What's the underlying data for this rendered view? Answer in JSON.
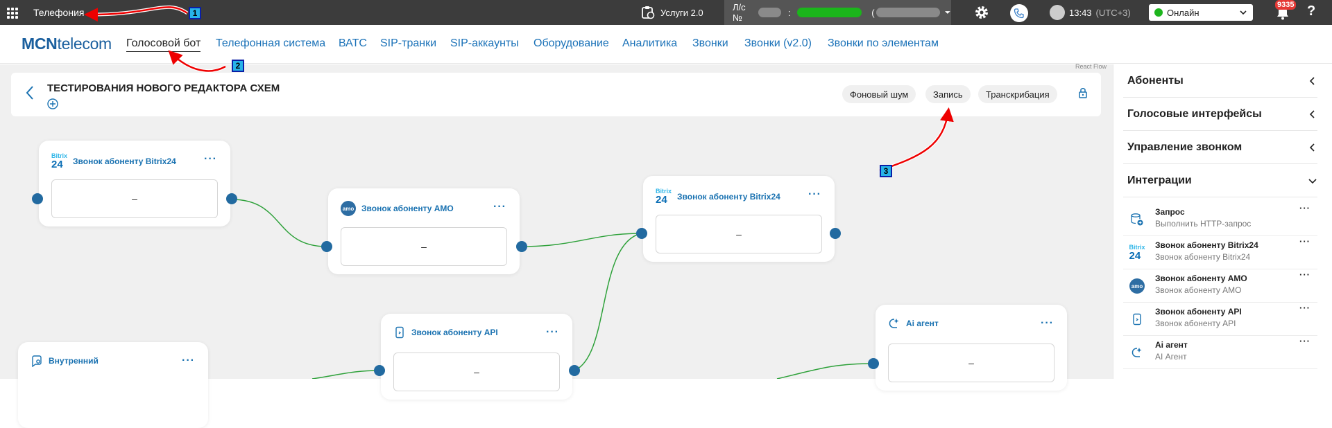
{
  "topbar": {
    "app_title": "Телефония",
    "services_label": "Услуги 2.0",
    "account_prefix": "Л/с №",
    "account_sep": ":",
    "account_paren": "(",
    "time": "13:43",
    "timezone": "(UTC+3)",
    "status": "Онлайн",
    "notifications_count": "9335",
    "help": "?"
  },
  "nav": {
    "logo_bold": "MCN",
    "logo_light": "telecom",
    "items": [
      "Голосовой бот",
      "Телефонная система",
      "ВАТС",
      "SIP-транки",
      "SIP-аккаунты",
      "Оборудование",
      "Аналитика",
      "Звонки",
      "Звонки (v2.0)",
      "Звонки по элементам"
    ]
  },
  "react_flow_label": "React Flow",
  "flow": {
    "title": "ТЕСТИРОВАНИЯ НОВОГО РЕДАКТОРА СХЕМ",
    "pills": [
      "Фоновый шум",
      "Запись",
      "Транскрибация"
    ]
  },
  "nodes": [
    {
      "title": "Звонок абоненту Bitrix24",
      "value": "–",
      "icon": "bitrix24-icon"
    },
    {
      "title": "Звонок абоненту АМО",
      "value": "–",
      "icon": "amo-icon"
    },
    {
      "title": "Звонок абоненту Bitrix24",
      "value": "–",
      "icon": "bitrix24-icon"
    },
    {
      "title": "Звонок абоненту API",
      "value": "–",
      "icon": "api-call-icon"
    },
    {
      "title": "Ai агент",
      "value": "–",
      "icon": "ai-agent-icon"
    },
    {
      "title": "Внутренний",
      "value": "",
      "icon": "internal-icon"
    }
  ],
  "node_menu": "···",
  "bitrix_logo": {
    "top": "Bitrix",
    "bottom": "24"
  },
  "amo_logo": "amo",
  "sidebar": {
    "sections": [
      "Абоненты",
      "Голосовые интерфейсы",
      "Управление звонком",
      "Интеграции"
    ],
    "items": [
      {
        "name": "Запрос",
        "desc": "Выполнить HTTP-запрос",
        "icon": "database-request-icon"
      },
      {
        "name": "Звонок абоненту Bitrix24",
        "desc": "Звонок абоненту Bitrix24",
        "icon": "bitrix24-icon"
      },
      {
        "name": "Звонок абоненту АМО",
        "desc": "Звонок абоненту АМО",
        "icon": "amo-icon"
      },
      {
        "name": "Звонок абоненту API",
        "desc": "Звонок абоненту API",
        "icon": "api-call-icon"
      },
      {
        "name": "Ai агент",
        "desc": "AI Агент",
        "icon": "ai-agent-icon"
      }
    ],
    "item_menu": "···"
  },
  "annotations": [
    "1",
    "2",
    "3"
  ],
  "colors": {
    "topbar": "#3c3c3c",
    "link": "#1b72b8",
    "node_title": "#1a72b1",
    "edge": "#2ea13a",
    "handle": "#226aa0",
    "online": "#1db51d"
  }
}
